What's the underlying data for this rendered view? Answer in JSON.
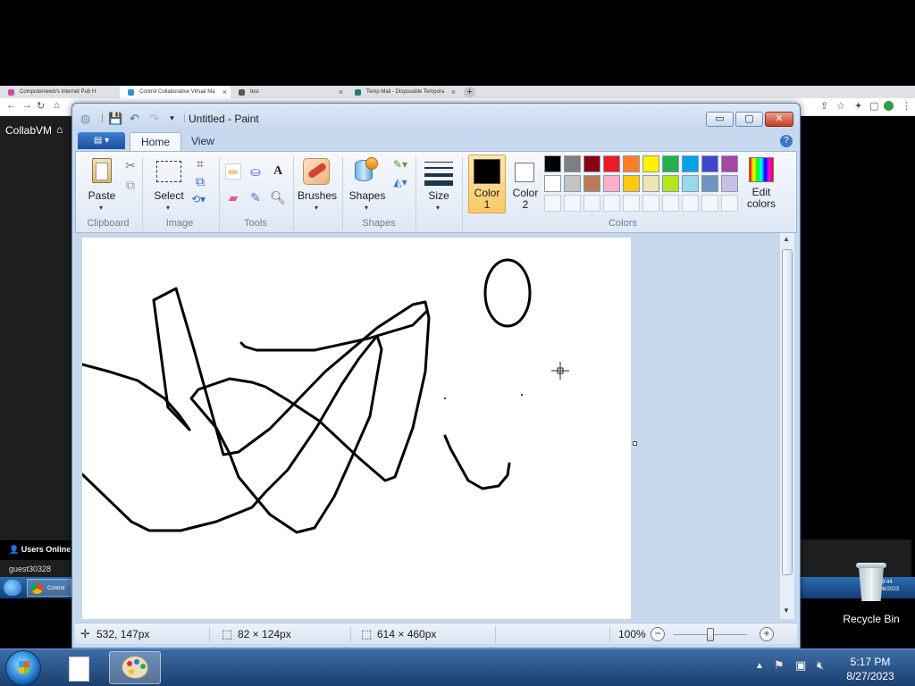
{
  "browser": {
    "tabs": [
      {
        "label": "Computernewb's Internet Pub H",
        "color": "#c94fa2"
      },
      {
        "label": "Control Collaborative Virtual Ma",
        "color": "#2d8fd6"
      },
      {
        "label": "test",
        "color": "#555555"
      },
      {
        "label": "Temp Mail - Disposable Tempora",
        "color": "#1e7d6b"
      }
    ],
    "new_tab": "+"
  },
  "site": {
    "title": "CollabVM",
    "users_online": "Users Online (",
    "users": [
      "guest30328"
    ],
    "inner_taskbar_app": "Control",
    "inner_clock": {
      "time": "19:44",
      "date": "12/06/2023"
    }
  },
  "desktop": {
    "recycle_bin_label": "Recycle Bin"
  },
  "paint": {
    "title": "Untitled - Paint",
    "tabs": {
      "home": "Home",
      "view": "View"
    },
    "groups": {
      "clipboard": "Clipboard",
      "image": "Image",
      "tools": "Tools",
      "shapes": "Shapes",
      "colors": "Colors"
    },
    "buttons": {
      "paste": "Paste",
      "select": "Select",
      "brushes": "Brushes",
      "shapes": "Shapes",
      "size": "Size",
      "color1_line1": "Color",
      "color1_line2": "1",
      "color2_line1": "Color",
      "color2_line2": "2",
      "edit_colors_line1": "Edit",
      "edit_colors_line2": "colors"
    },
    "color1": "#000000",
    "color2": "#ffffff",
    "palette": [
      "#000000",
      "#7f7f7f",
      "#880015",
      "#ed1c24",
      "#ff7f27",
      "#fff200",
      "#22b14c",
      "#00a2e8",
      "#3f48cc",
      "#a349a4",
      "#ffffff",
      "#c3c3c3",
      "#b97a57",
      "#ffaec9",
      "#ffc90e",
      "#efe4b0",
      "#b5e61d",
      "#99d9ea",
      "#7092be",
      "#c8bfe7"
    ],
    "status": {
      "cursor_position": "532, 147px",
      "selection_size": "82 × 124px",
      "canvas_size": "614 × 460px",
      "zoom": "100%",
      "zoom_level": 1.0
    }
  },
  "taskbar": {
    "time": "5:17 PM",
    "date": "8/27/2023"
  }
}
